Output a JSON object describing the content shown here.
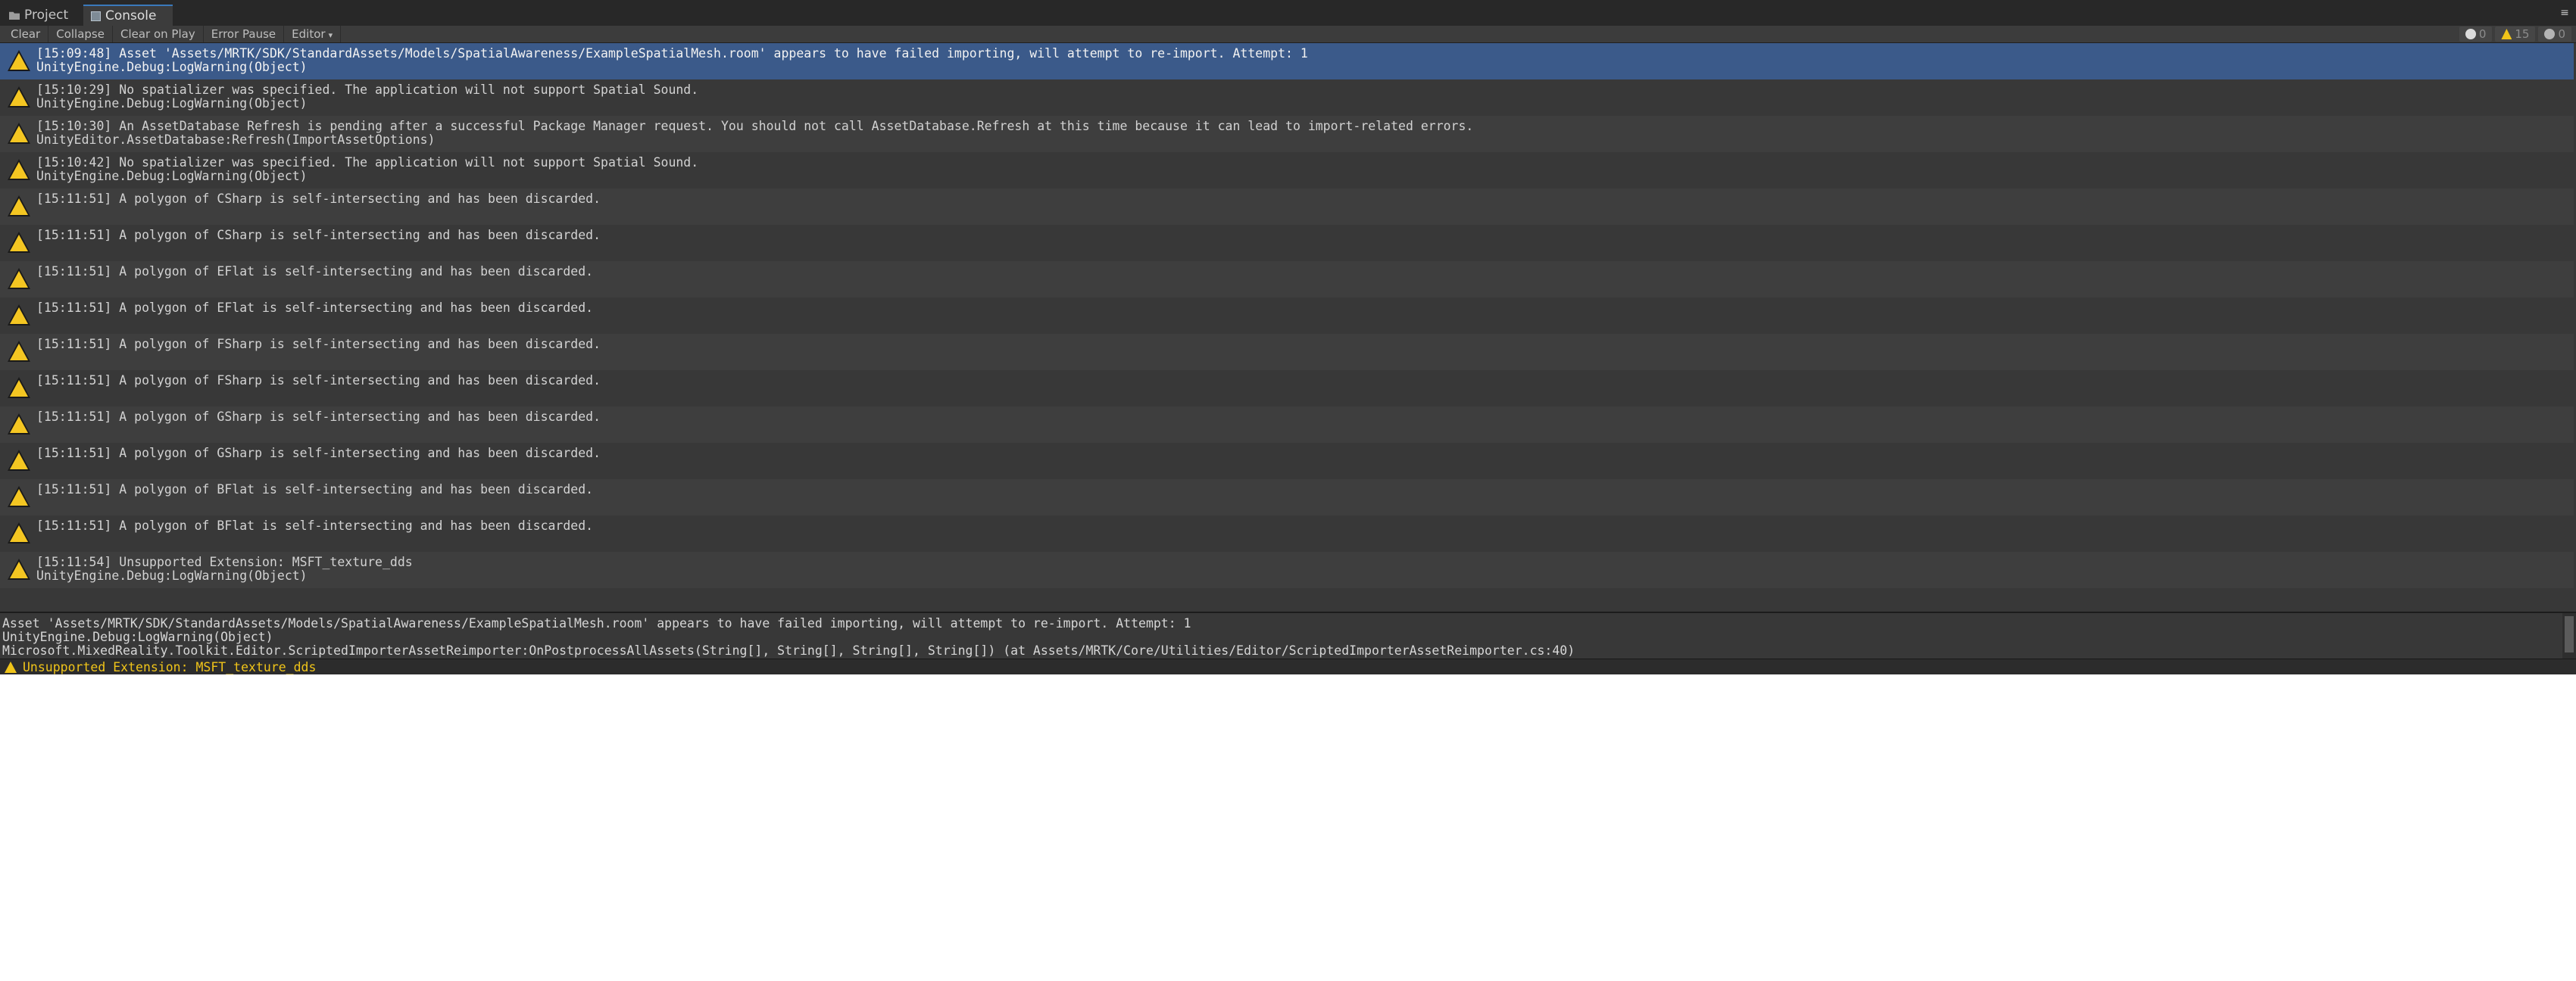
{
  "tabs": [
    {
      "label": "Project",
      "icon": "folder-icon"
    },
    {
      "label": "Console",
      "icon": "console-icon"
    }
  ],
  "toolbar": {
    "clear": "Clear",
    "collapse": "Collapse",
    "clear_on_play": "Clear on Play",
    "error_pause": "Error Pause",
    "editor": "Editor",
    "info_count": "0",
    "warning_count": "15",
    "error_count": "0"
  },
  "colors": {
    "selected_row": "#3b5a8a",
    "warning": "#f4c622",
    "status_text": "#f0c419"
  },
  "logs": [
    {
      "line1": "[15:09:48] Asset 'Assets/MRTK/SDK/StandardAssets/Models/SpatialAwareness/ExampleSpatialMesh.room' appears to have failed importing, will attempt to re-import. Attempt: 1",
      "line2": "UnityEngine.Debug:LogWarning(Object)",
      "selected": true
    },
    {
      "line1": "[15:10:29] No spatializer was specified. The application will not support Spatial Sound.",
      "line2": "UnityEngine.Debug:LogWarning(Object)"
    },
    {
      "line1": "[15:10:30] An AssetDatabase Refresh is pending after a successful Package Manager request. You should not call AssetDatabase.Refresh at this time because it can lead to import-related errors.",
      "line2": "UnityEditor.AssetDatabase:Refresh(ImportAssetOptions)"
    },
    {
      "line1": "[15:10:42] No spatializer was specified. The application will not support Spatial Sound.",
      "line2": "UnityEngine.Debug:LogWarning(Object)"
    },
    {
      "line1": "[15:11:51] A polygon of CSharp is self-intersecting and has been discarded.",
      "line2": ""
    },
    {
      "line1": "[15:11:51] A polygon of CSharp is self-intersecting and has been discarded.",
      "line2": ""
    },
    {
      "line1": "[15:11:51] A polygon of EFlat is self-intersecting and has been discarded.",
      "line2": ""
    },
    {
      "line1": "[15:11:51] A polygon of EFlat is self-intersecting and has been discarded.",
      "line2": ""
    },
    {
      "line1": "[15:11:51] A polygon of FSharp is self-intersecting and has been discarded.",
      "line2": ""
    },
    {
      "line1": "[15:11:51] A polygon of FSharp is self-intersecting and has been discarded.",
      "line2": ""
    },
    {
      "line1": "[15:11:51] A polygon of GSharp is self-intersecting and has been discarded.",
      "line2": ""
    },
    {
      "line1": "[15:11:51] A polygon of GSharp is self-intersecting and has been discarded.",
      "line2": ""
    },
    {
      "line1": "[15:11:51] A polygon of BFlat is self-intersecting and has been discarded.",
      "line2": ""
    },
    {
      "line1": "[15:11:51] A polygon of BFlat is self-intersecting and has been discarded.",
      "line2": ""
    },
    {
      "line1": "[15:11:54] Unsupported Extension: MSFT_texture_dds",
      "line2": "UnityEngine.Debug:LogWarning(Object)"
    }
  ],
  "detail": {
    "line1": "Asset 'Assets/MRTK/SDK/StandardAssets/Models/SpatialAwareness/ExampleSpatialMesh.room' appears to have failed importing, will attempt to re-import. Attempt: 1",
    "line2": "UnityEngine.Debug:LogWarning(Object)",
    "line3": "Microsoft.MixedReality.Toolkit.Editor.ScriptedImporterAssetReimporter:OnPostprocessAllAssets(String[], String[], String[], String[]) (at Assets/MRTK/Core/Utilities/Editor/ScriptedImporterAssetReimporter.cs:40)"
  },
  "status": {
    "message": "Unsupported Extension: MSFT_texture_dds"
  }
}
